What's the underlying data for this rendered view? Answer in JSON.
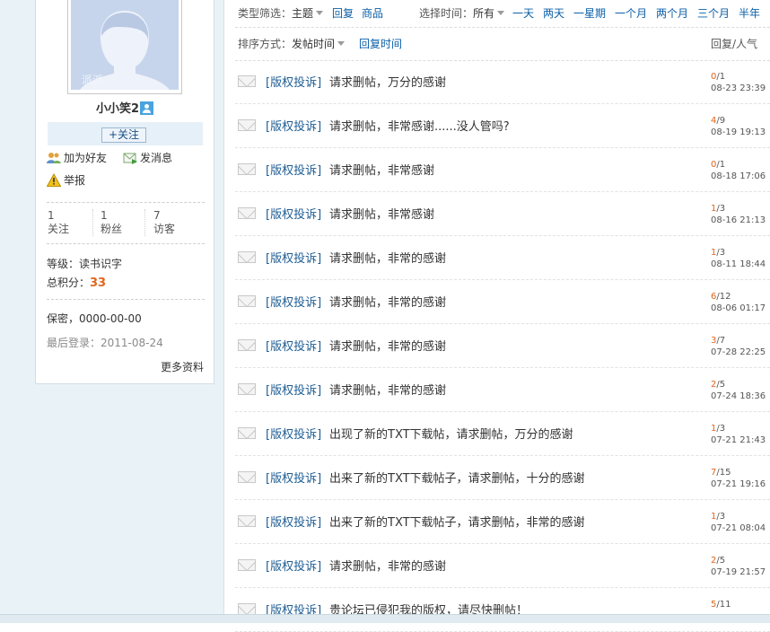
{
  "profile": {
    "avatar_watermark": "派派",
    "username": "小小笑2",
    "follow_button": "+关注",
    "actions": {
      "add_friend": "加为好友",
      "send_message": "发消息",
      "report": "举报"
    },
    "stats": [
      {
        "value": "1",
        "label": "关注"
      },
      {
        "value": "1",
        "label": "粉丝"
      },
      {
        "value": "7",
        "label": "访客"
      }
    ],
    "level": "等级：读书识字",
    "credits_label": "总积分：",
    "credits_value": "33",
    "birthday": "保密，0000-00-00",
    "last_login": "最后登录：2011-08-24",
    "more_info": "更多资料"
  },
  "filter": {
    "type_label": "类型筛选：",
    "type_value": "主题",
    "type_options": [
      "回复",
      "商品"
    ],
    "time_label": "选择时间：",
    "time_value": "所有",
    "time_options": [
      "一天",
      "两天",
      "一星期",
      "一个月",
      "两个月",
      "三个月",
      "半年"
    ]
  },
  "sort": {
    "label": "排序方式：",
    "value": "发帖时间",
    "alt": "回复时间",
    "column_header": "回复/人气"
  },
  "posts": [
    {
      "tag": "[版权投诉]",
      "title": "请求删帖，万分的感谢",
      "replies": "0",
      "views": "1",
      "date": "08-23 23:39"
    },
    {
      "tag": "[版权投诉]",
      "title": "请求删帖，非常感谢......没人管吗?",
      "replies": "4",
      "views": "9",
      "date": "08-19 19:13"
    },
    {
      "tag": "[版权投诉]",
      "title": "请求删帖，非常感谢",
      "replies": "0",
      "views": "1",
      "date": "08-18 17:06"
    },
    {
      "tag": "[版权投诉]",
      "title": "请求删帖，非常感谢",
      "replies": "1",
      "views": "3",
      "date": "08-16 21:13"
    },
    {
      "tag": "[版权投诉]",
      "title": "请求删帖，非常的感谢",
      "replies": "1",
      "views": "3",
      "date": "08-11 18:44"
    },
    {
      "tag": "[版权投诉]",
      "title": "请求删帖，非常的感谢",
      "replies": "6",
      "views": "12",
      "date": "08-06 01:17"
    },
    {
      "tag": "[版权投诉]",
      "title": "请求删帖，非常的感谢",
      "replies": "3",
      "views": "7",
      "date": "07-28 22:25"
    },
    {
      "tag": "[版权投诉]",
      "title": "请求删帖，非常的感谢",
      "replies": "2",
      "views": "5",
      "date": "07-24 18:36"
    },
    {
      "tag": "[版权投诉]",
      "title": "出现了新的TXT下载帖，请求删帖，万分的感谢",
      "replies": "1",
      "views": "3",
      "date": "07-21 21:43"
    },
    {
      "tag": "[版权投诉]",
      "title": "出来了新的TXT下载帖子，请求删帖，十分的感谢",
      "replies": "7",
      "views": "15",
      "date": "07-21 19:16"
    },
    {
      "tag": "[版权投诉]",
      "title": "出来了新的TXT下载帖子，请求删帖，非常的感谢",
      "replies": "1",
      "views": "3",
      "date": "07-21 08:04"
    },
    {
      "tag": "[版权投诉]",
      "title": "请求删帖，非常的感谢",
      "replies": "2",
      "views": "5",
      "date": "07-19 21:57"
    },
    {
      "tag": "[版权投诉]",
      "title": "贵论坛已侵犯我的版权，请尽快删帖！",
      "replies": "5",
      "views": "11",
      "date": ""
    }
  ]
}
